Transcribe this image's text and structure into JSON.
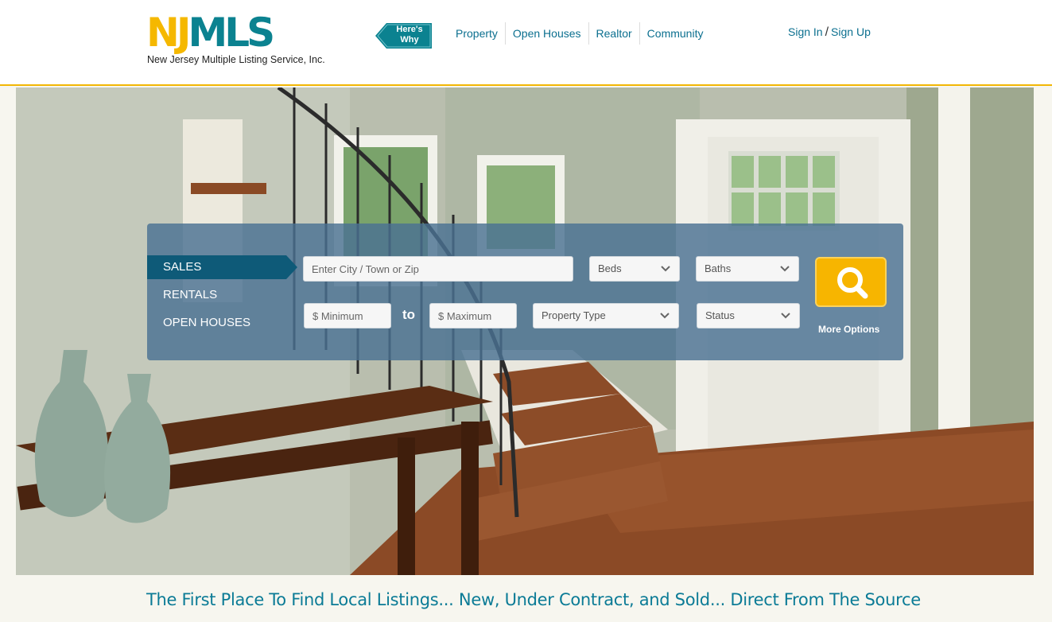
{
  "header": {
    "logo_mark_a": "NJ",
    "logo_mark_b": "MLS",
    "logo_subtitle": "New Jersey Multiple Listing Service, Inc.",
    "promo_line1": "Here's",
    "promo_line2": "Why",
    "nav": [
      "Property",
      "Open Houses",
      "Realtor",
      "Community"
    ],
    "sign_in": "Sign In",
    "separator": "/",
    "sign_up": "Sign Up",
    "accent_color": "#f2b705",
    "brand_color": "#0b8290"
  },
  "search": {
    "modes": [
      "SALES",
      "RENTALS",
      "OPEN HOUSES"
    ],
    "active_mode": "SALES",
    "location_placeholder": "Enter City / Town or Zip",
    "beds": "Beds",
    "baths": "Baths",
    "min_placeholder": "$ Minimum",
    "to": "to",
    "max_placeholder": "$ Maximum",
    "property_type": "Property Type",
    "status": "Status",
    "more_options": "More Options",
    "button_icon": "magnifier-icon"
  },
  "tagline": "The First Place To Find Local Listings... New, Under Contract, and Sold... Direct From The Source"
}
